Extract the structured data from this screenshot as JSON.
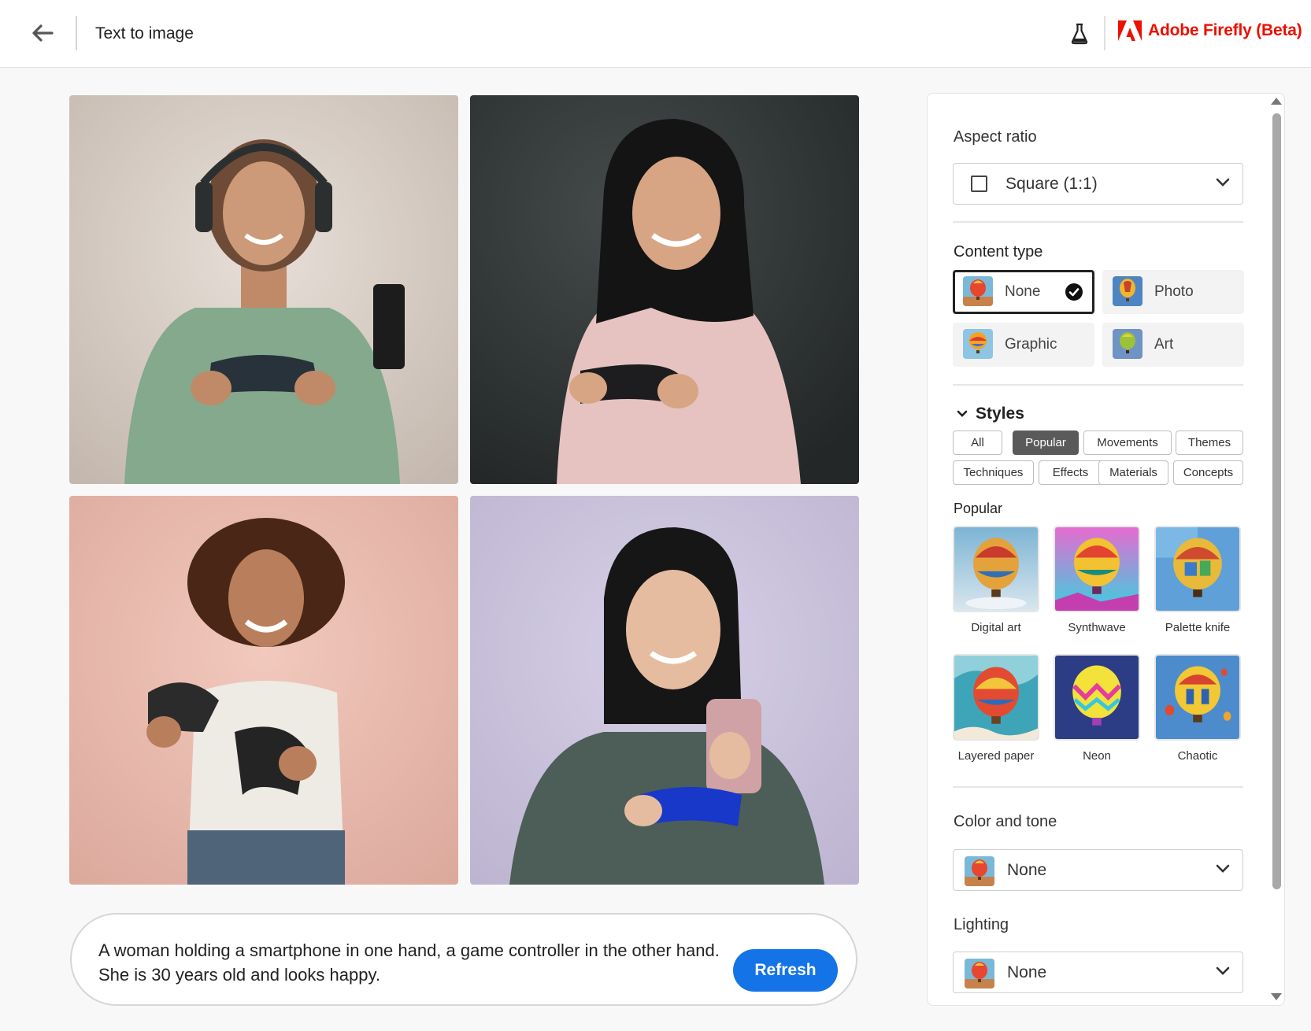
{
  "header": {
    "title": "Text to image",
    "brand": "Adobe Firefly (Beta)"
  },
  "prompt": {
    "text": "A woman holding a smartphone in one hand, a game controller in the other hand. She is 30 years old and looks happy.",
    "refresh_label": "Refresh"
  },
  "panel": {
    "aspect_ratio": {
      "heading": "Aspect ratio",
      "value": "Square (1:1)"
    },
    "content_type": {
      "heading": "Content type",
      "options": [
        {
          "label": "None",
          "selected": true
        },
        {
          "label": "Photo",
          "selected": false
        },
        {
          "label": "Graphic",
          "selected": false
        },
        {
          "label": "Art",
          "selected": false
        }
      ]
    },
    "styles": {
      "heading": "Styles",
      "chips": [
        {
          "label": "All",
          "active": false
        },
        {
          "label": "Popular",
          "active": true
        },
        {
          "label": "Movements",
          "active": false
        },
        {
          "label": "Themes",
          "active": false
        },
        {
          "label": "Techniques",
          "active": false
        },
        {
          "label": "Effects",
          "active": false
        },
        {
          "label": "Materials",
          "active": false
        },
        {
          "label": "Concepts",
          "active": false
        }
      ],
      "section_label": "Popular",
      "items": [
        {
          "label": "Digital art"
        },
        {
          "label": "Synthwave"
        },
        {
          "label": "Palette knife"
        },
        {
          "label": "Layered paper"
        },
        {
          "label": "Neon"
        },
        {
          "label": "Chaotic"
        }
      ]
    },
    "color_tone": {
      "heading": "Color and tone",
      "value": "None"
    },
    "lighting": {
      "heading": "Lighting",
      "value": "None"
    }
  },
  "colors": {
    "brand_red": "#eb1000",
    "accent_blue": "#1473e6",
    "chip_active": "#5a5a5a"
  }
}
